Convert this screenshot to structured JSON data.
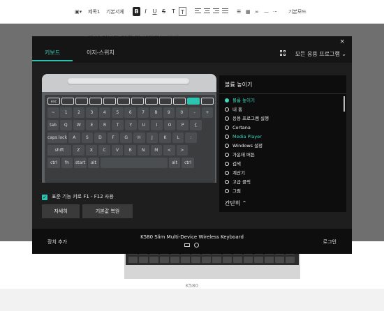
{
  "editor_toolbar": {
    "image_icon": "image-icon",
    "heading_label": "제목1",
    "font_label": "기본서체",
    "bold": "B",
    "italic": "I",
    "underline": "U",
    "strike": "S",
    "text_color": "T",
    "text_bg": "T",
    "more_label": "···",
    "mode_label": "기본모드"
  },
  "document": {
    "blurred_title": "• 무선 키보드 연결 및 설정하는 방법",
    "image_caption": "K580"
  },
  "dialog": {
    "close_label": "×",
    "tabs": [
      {
        "label": "키보드",
        "active": true
      },
      {
        "label": "이지-스위치",
        "active": false
      }
    ],
    "apps_label": "모든 응용 프로그램",
    "apps_icon": "grid-icon",
    "function_keys": {
      "checkbox_label": "표준 기능 키로 F1 - F12 사용",
      "checked": true
    },
    "buttons": {
      "details": "자세히",
      "restore": "기본값 복원"
    },
    "panel": {
      "title": "볼륨 높이기",
      "options": [
        {
          "label": "볼륨 높이기",
          "selected": true
        },
        {
          "label": "내 홈",
          "selected": false
        },
        {
          "label": "응용 프로그램 실행",
          "selected": false
        },
        {
          "label": "Cortana",
          "selected": false
        },
        {
          "label": "Media Player",
          "selected": false,
          "highlight": true
        },
        {
          "label": "Windows 설정",
          "selected": false
        },
        {
          "label": "가운데 버튼",
          "selected": false
        },
        {
          "label": "검색",
          "selected": false
        },
        {
          "label": "계산기",
          "selected": false
        },
        {
          "label": "고급 클릭",
          "selected": false
        },
        {
          "label": "그림",
          "selected": false
        }
      ],
      "less_label": "간단히"
    },
    "keyboard": {
      "fn_row": [
        "esc",
        "",
        "",
        "",
        "",
        "",
        "",
        "",
        "",
        "",
        "",
        ""
      ],
      "row1": [
        "~",
        "1",
        "2",
        "3",
        "4",
        "5",
        "6",
        "7",
        "8",
        "9",
        "0",
        "-",
        "+"
      ],
      "row2": [
        "tab",
        "Q",
        "W",
        "E",
        "R",
        "T",
        "Y",
        "U",
        "I",
        "O",
        "P",
        "{"
      ],
      "row3": [
        "caps lock",
        "A",
        "S",
        "D",
        "F",
        "G",
        "H",
        "J",
        "K",
        "L",
        ":"
      ],
      "row4": [
        "shift",
        "Z",
        "X",
        "C",
        "V",
        "B",
        "N",
        "M",
        "<",
        ">"
      ],
      "row5": [
        "ctrl",
        "fn",
        "start",
        "alt",
        "",
        "alt",
        "ctrl"
      ]
    },
    "footer": {
      "add_device": "장치 추가",
      "device_name": "K580 Slim Multi-Device Wireless Keyboard",
      "login": "로그인"
    },
    "colors": {
      "accent": "#2cc3b0",
      "dialog_bg": "#1e1e1e",
      "panel_bg": "#0d0d0d"
    }
  }
}
